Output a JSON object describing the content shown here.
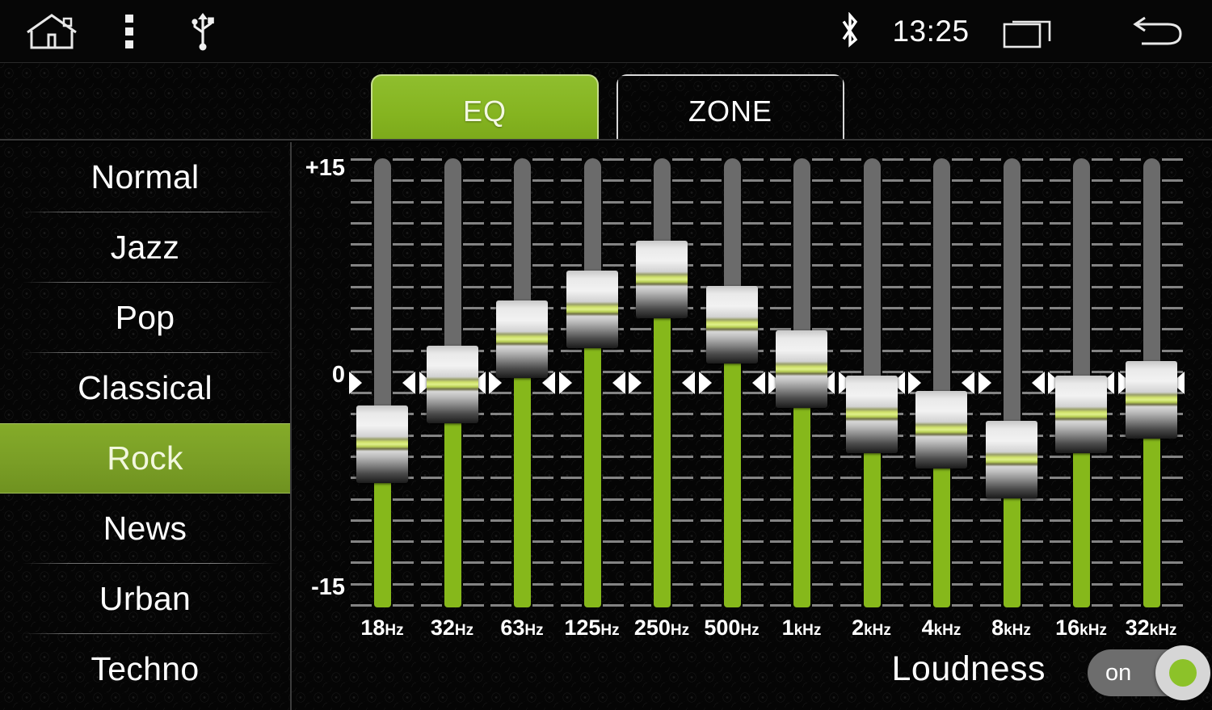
{
  "statusbar": {
    "home_icon": "home-icon",
    "menu_icon": "overflow-menu-icon",
    "usb_icon": "usb-icon",
    "bluetooth_icon": "bluetooth-icon",
    "clock": "13:25",
    "recents_icon": "recent-apps-icon",
    "back_icon": "back-arrow-icon"
  },
  "tabs": [
    {
      "label": "EQ",
      "active": true
    },
    {
      "label": "ZONE",
      "active": false
    }
  ],
  "presets": [
    {
      "label": "Normal",
      "selected": false
    },
    {
      "label": "Jazz",
      "selected": false
    },
    {
      "label": "Pop",
      "selected": false
    },
    {
      "label": "Classical",
      "selected": false
    },
    {
      "label": "Rock",
      "selected": true
    },
    {
      "label": "News",
      "selected": false
    },
    {
      "label": "Urban",
      "selected": false
    },
    {
      "label": "Techno",
      "selected": false
    }
  ],
  "equalizer": {
    "scale_top": "+15",
    "scale_mid": "0",
    "scale_bottom": "-15",
    "range_db": [
      -15,
      15
    ],
    "bands": [
      {
        "freq_value": "18",
        "freq_unit": "Hz",
        "gain_db": -4
      },
      {
        "freq_value": "32",
        "freq_unit": "Hz",
        "gain_db": 0
      },
      {
        "freq_value": "63",
        "freq_unit": "Hz",
        "gain_db": 3
      },
      {
        "freq_value": "125",
        "freq_unit": "Hz",
        "gain_db": 5
      },
      {
        "freq_value": "250",
        "freq_unit": "Hz",
        "gain_db": 7
      },
      {
        "freq_value": "500",
        "freq_unit": "Hz",
        "gain_db": 4
      },
      {
        "freq_value": "1",
        "freq_unit": "kHz",
        "gain_db": 1
      },
      {
        "freq_value": "2",
        "freq_unit": "kHz",
        "gain_db": -2
      },
      {
        "freq_value": "4",
        "freq_unit": "kHz",
        "gain_db": -3
      },
      {
        "freq_value": "8",
        "freq_unit": "kHz",
        "gain_db": -5
      },
      {
        "freq_value": "16",
        "freq_unit": "kHz",
        "gain_db": -2
      },
      {
        "freq_value": "32",
        "freq_unit": "kHz",
        "gain_db": -1
      }
    ]
  },
  "loudness": {
    "label": "Loudness",
    "state": "on",
    "enabled": true
  },
  "colors": {
    "accent_green": "#86b81b",
    "tab_green": "#85b420",
    "selected_row_green": "#7a9e26",
    "track_gray": "#6b6b6b",
    "background": "#050505"
  }
}
